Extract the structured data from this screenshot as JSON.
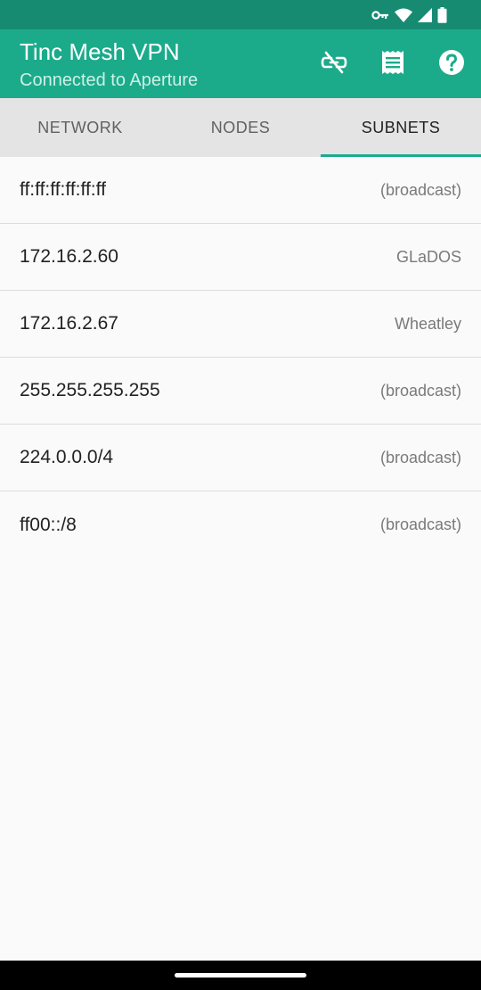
{
  "status_bar": {
    "icons": [
      "vpn-key-icon",
      "wifi-icon",
      "cellular-signal-icon",
      "battery-icon"
    ]
  },
  "app_bar": {
    "title": "Tinc Mesh VPN",
    "subtitle": "Connected to Aperture",
    "actions": [
      "disconnect-icon",
      "logs-icon",
      "help-icon"
    ]
  },
  "tabs": [
    {
      "label": "NETWORK",
      "active": false
    },
    {
      "label": "NODES",
      "active": false
    },
    {
      "label": "SUBNETS",
      "active": true
    }
  ],
  "subnets": [
    {
      "subnet": "ff:ff:ff:ff:ff:ff",
      "owner": "(broadcast)"
    },
    {
      "subnet": "172.16.2.60",
      "owner": "GLaDOS"
    },
    {
      "subnet": "172.16.2.67",
      "owner": "Wheatley"
    },
    {
      "subnet": "255.255.255.255",
      "owner": "(broadcast)"
    },
    {
      "subnet": "224.0.0.0/4",
      "owner": "(broadcast)"
    },
    {
      "subnet": "ff00::/8",
      "owner": "(broadcast)"
    }
  ],
  "colors": {
    "status_bar": "#168b72",
    "primary": "#1bab8b",
    "tab_bar": "#e4e4e4",
    "background": "#fafafa",
    "nav_bar": "#000000"
  }
}
